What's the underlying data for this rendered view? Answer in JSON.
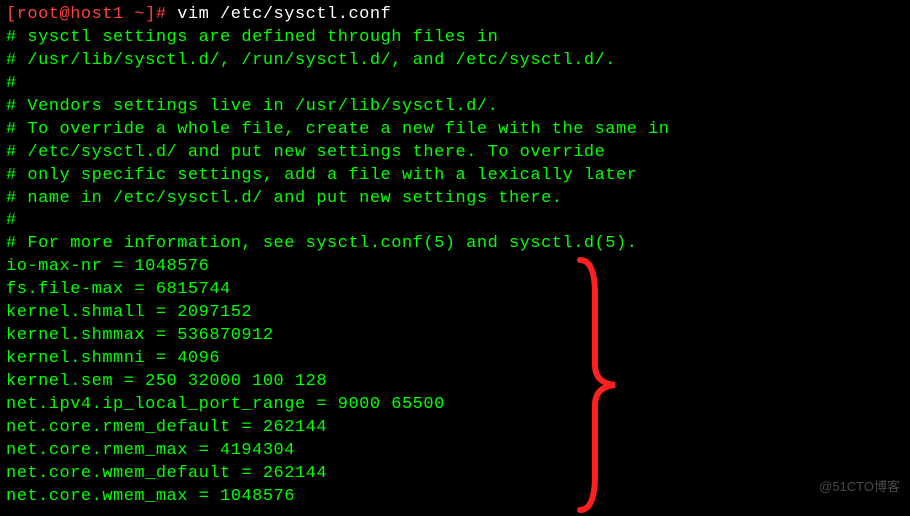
{
  "prompt": {
    "user_host": "[root@host1 ~]# ",
    "command": "vim /etc/sysctl.conf"
  },
  "file_content": [
    "# sysctl settings are defined through files in",
    "# /usr/lib/sysctl.d/, /run/sysctl.d/, and /etc/sysctl.d/.",
    "#",
    "# Vendors settings live in /usr/lib/sysctl.d/.",
    "# To override a whole file, create a new file with the same in",
    "# /etc/sysctl.d/ and put new settings there. To override",
    "# only specific settings, add a file with a lexically later",
    "# name in /etc/sysctl.d/ and put new settings there.",
    "#",
    "# For more information, see sysctl.conf(5) and sysctl.d(5).",
    "io-max-nr = 1048576",
    "fs.file-max = 6815744",
    "kernel.shmall = 2097152",
    "kernel.shmmax = 536870912",
    "kernel.shmmni = 4096",
    "kernel.sem = 250 32000 100 128",
    "net.ipv4.ip_local_port_range = 9000 65500",
    "net.core.rmem_default = 262144",
    "net.core.rmem_max = 4194304",
    "net.core.wmem_default = 262144",
    "net.core.wmem_max = 1048576"
  ],
  "watermark": "@51CTO博客"
}
